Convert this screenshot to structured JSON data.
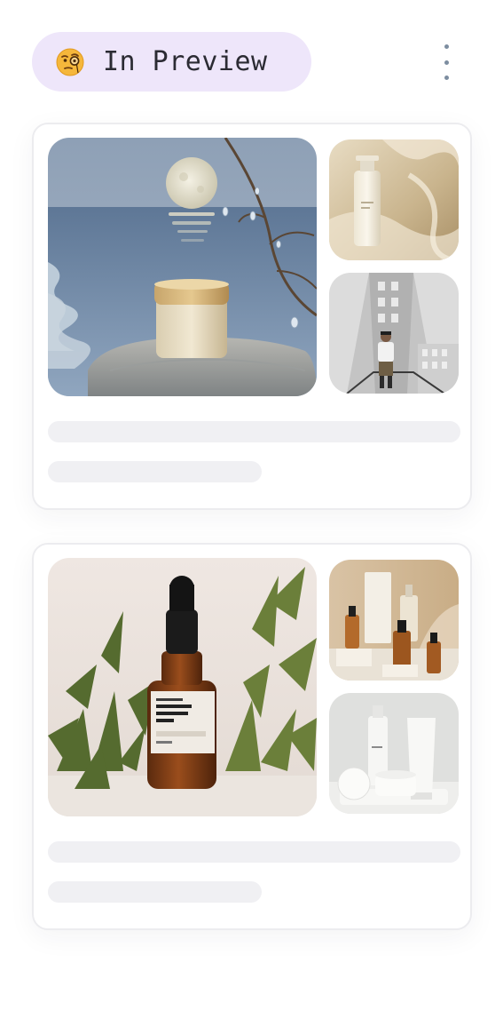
{
  "header": {
    "badge_label": "In Preview",
    "badge_emoji": "face-with-monocle-icon",
    "menu_icon": "more-vertical-icon"
  },
  "colors": {
    "badge_bg": "#eee6fa",
    "skeleton": "#f0f0f3",
    "card_border": "#ececef",
    "menu_dots": "#7d8da0"
  },
  "cards": [
    {
      "images": [
        "moon-jar-product-photo",
        "pump-bottle-product-photo",
        "man-on-building-photo"
      ]
    },
    {
      "images": [
        "amber-dropper-bottle-photo",
        "serum-bottles-set-photo",
        "white-skincare-set-photo"
      ]
    }
  ]
}
